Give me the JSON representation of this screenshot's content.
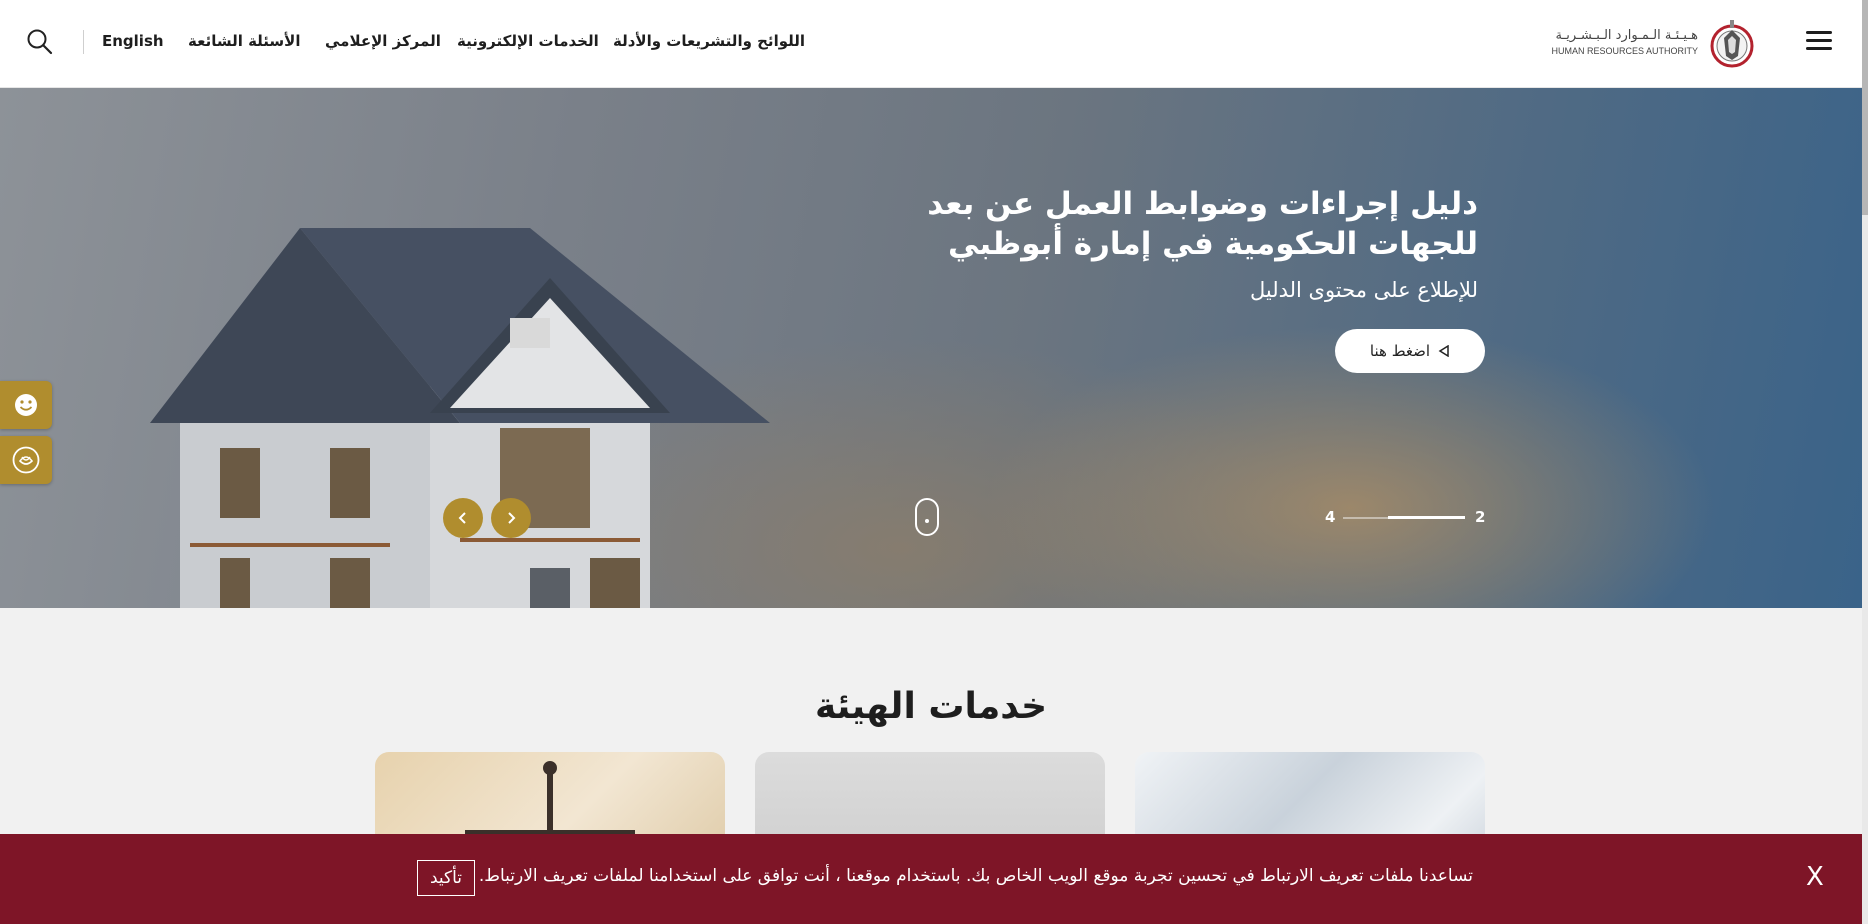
{
  "header": {
    "language_label": "English",
    "nav": [
      {
        "label": "الأسئلة الشائعة"
      },
      {
        "label": "المركز الإعلامي"
      },
      {
        "label": "الخدمات الإلكترونية"
      },
      {
        "label": "اللوائح والتشريعات والأدلة"
      }
    ],
    "logo_text_ar": "هـيـئـة الـمـوارد الـبـشـريـة",
    "logo_text_en": "HUMAN RESOURCES AUTHORITY"
  },
  "hero": {
    "title_line1": "دليل إجراءات وضوابط العمل عن بعد",
    "title_line2": "للجهات الحكومية في إمارة أبوظبي",
    "subtitle": "للإطلاع على محتوى الدليل",
    "button_label": "اضغط هنا",
    "pager_current": "2",
    "pager_total": "4"
  },
  "services": {
    "title": "خدمات الهيئة"
  },
  "cookie_banner": {
    "text": "تساعدنا ملفات تعريف الارتباط في تحسين تجربة موقع الويب الخاص بك. باستخدام موقعنا ، أنت توافق على استخدامنا لملفات تعريف الارتباط.",
    "confirm_label": "تأكيد",
    "close_label": "X"
  },
  "icons": {
    "search": "search-icon",
    "menu": "hamburger-menu-icon",
    "accessibility": "smiley-icon",
    "happiness": "happiness-meter-icon",
    "prev": "chevron-left-icon",
    "next": "chevron-right-icon"
  },
  "colors": {
    "accent_gold": "#b08d2e",
    "cookie_bg": "#7e1527"
  }
}
